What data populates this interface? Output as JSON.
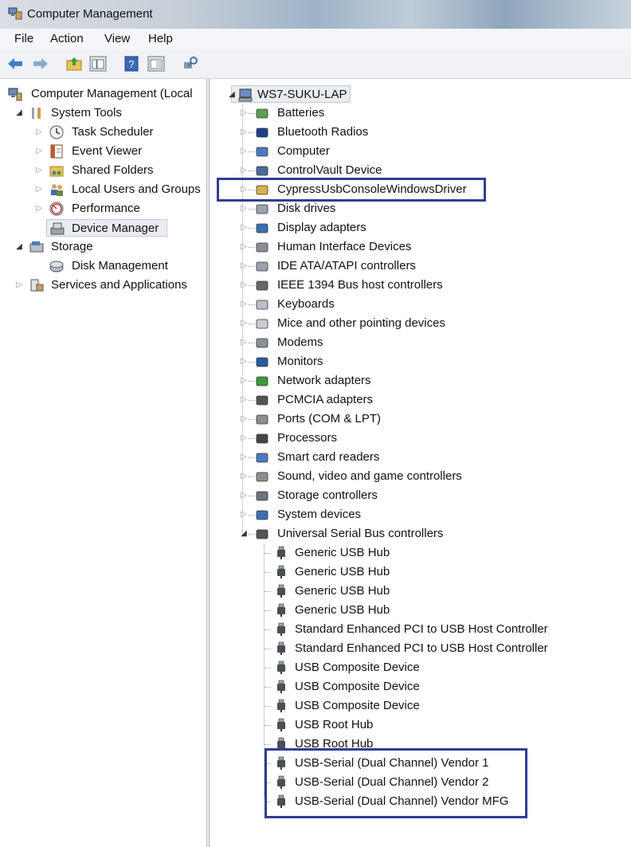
{
  "window": {
    "title": "Computer Management"
  },
  "menu": [
    "File",
    "Action",
    "View",
    "Help"
  ],
  "toolbar": {
    "buttons": [
      "back-arrow-icon",
      "forward-arrow-icon",
      "up-folder-icon",
      "show-hide-tree-icon",
      "help-icon",
      "properties-icon",
      "device-scan-icon"
    ]
  },
  "left_tree": {
    "root": "Computer Management (Local",
    "system_tools": "System Tools",
    "task_scheduler": "Task Scheduler",
    "event_viewer": "Event Viewer",
    "shared_folders": "Shared Folders",
    "local_users": "Local Users and Groups",
    "performance": "Performance",
    "device_manager": "Device Manager",
    "storage": "Storage",
    "disk_management": "Disk Management",
    "services": "Services and Applications"
  },
  "device_tree": {
    "root": "WS7-SUKU-LAP",
    "categories": [
      "Batteries",
      "Bluetooth Radios",
      "Computer",
      "ControlVault Device",
      "CypressUsbConsoleWindowsDriver",
      "Disk drives",
      "Display adapters",
      "Human Interface Devices",
      "IDE ATA/ATAPI controllers",
      "IEEE 1394 Bus host controllers",
      "Keyboards",
      "Mice and other pointing devices",
      "Modems",
      "Monitors",
      "Network adapters",
      "PCMCIA adapters",
      "Ports (COM & LPT)",
      "Processors",
      "Smart card readers",
      "Sound, video and game controllers",
      "Storage controllers",
      "System devices",
      "Universal Serial Bus controllers"
    ],
    "usb_children": [
      "Generic USB Hub",
      "Generic USB Hub",
      "Generic USB Hub",
      "Generic USB Hub",
      "Standard Enhanced PCI to USB Host Controller",
      "Standard Enhanced PCI to USB Host Controller",
      "USB Composite Device",
      "USB Composite Device",
      "USB Composite Device",
      "USB Root Hub",
      "USB Root Hub",
      "USB-Serial (Dual Channel) Vendor 1",
      "USB-Serial (Dual Channel) Vendor 2",
      "USB-Serial (Dual Channel) Vendor MFG"
    ]
  },
  "colors": {
    "highlight_box": "#2c3e94",
    "selection": "#e9edf2"
  }
}
